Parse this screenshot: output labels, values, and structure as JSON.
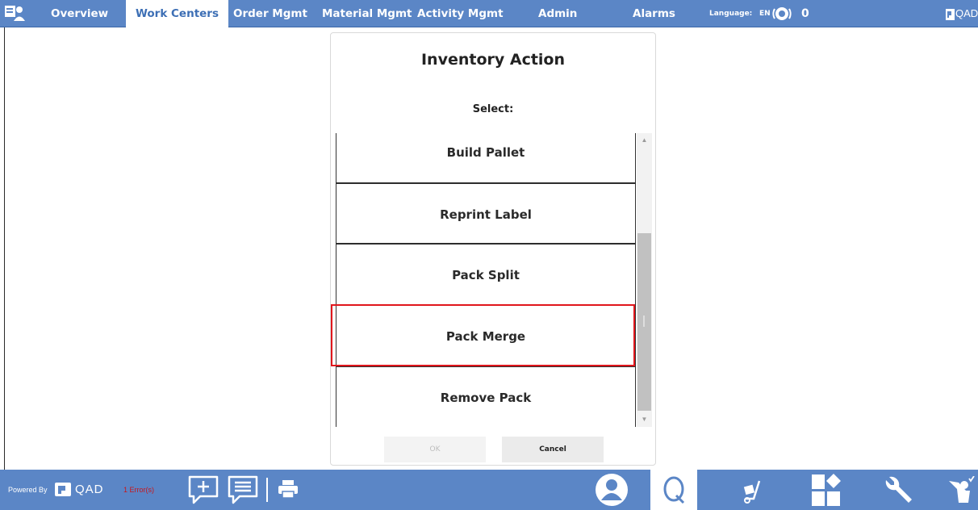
{
  "nav": {
    "tabs": [
      {
        "label": "Overview"
      },
      {
        "label": "Work Centers"
      },
      {
        "label": "Order Mgmt"
      },
      {
        "label": "Material Mgmt"
      },
      {
        "label": "Activity Mgmt"
      },
      {
        "label": "Admin"
      },
      {
        "label": "Alarms"
      }
    ],
    "active_tab": "Work Centers",
    "language_label": "Language:",
    "language_code": "EN",
    "alarm_count": "0",
    "brand": "QAD"
  },
  "dialog": {
    "title": "Inventory Action",
    "subtitle": "Select:",
    "items": [
      {
        "label": "Build Pallet"
      },
      {
        "label": "Reprint Label"
      },
      {
        "label": "Pack Split"
      },
      {
        "label": "Pack Merge"
      },
      {
        "label": "Remove Pack"
      }
    ],
    "highlighted_item": "Pack Merge",
    "ok_label": "OK",
    "cancel_label": "Cancel"
  },
  "footer": {
    "powered_by": "Powered By",
    "brand": "QAD",
    "errors": "1 Error(s)"
  },
  "colors": {
    "bar": "#5b86c6",
    "highlight": "#e0161c",
    "error": "#c8161c"
  },
  "icons": [
    "user-card-icon",
    "alarm-icon",
    "add-comment-icon",
    "comments-icon",
    "print-icon",
    "operator-icon",
    "quality-icon",
    "hand-truck-icon",
    "layout-icon",
    "wrench-icon",
    "done-icon"
  ]
}
